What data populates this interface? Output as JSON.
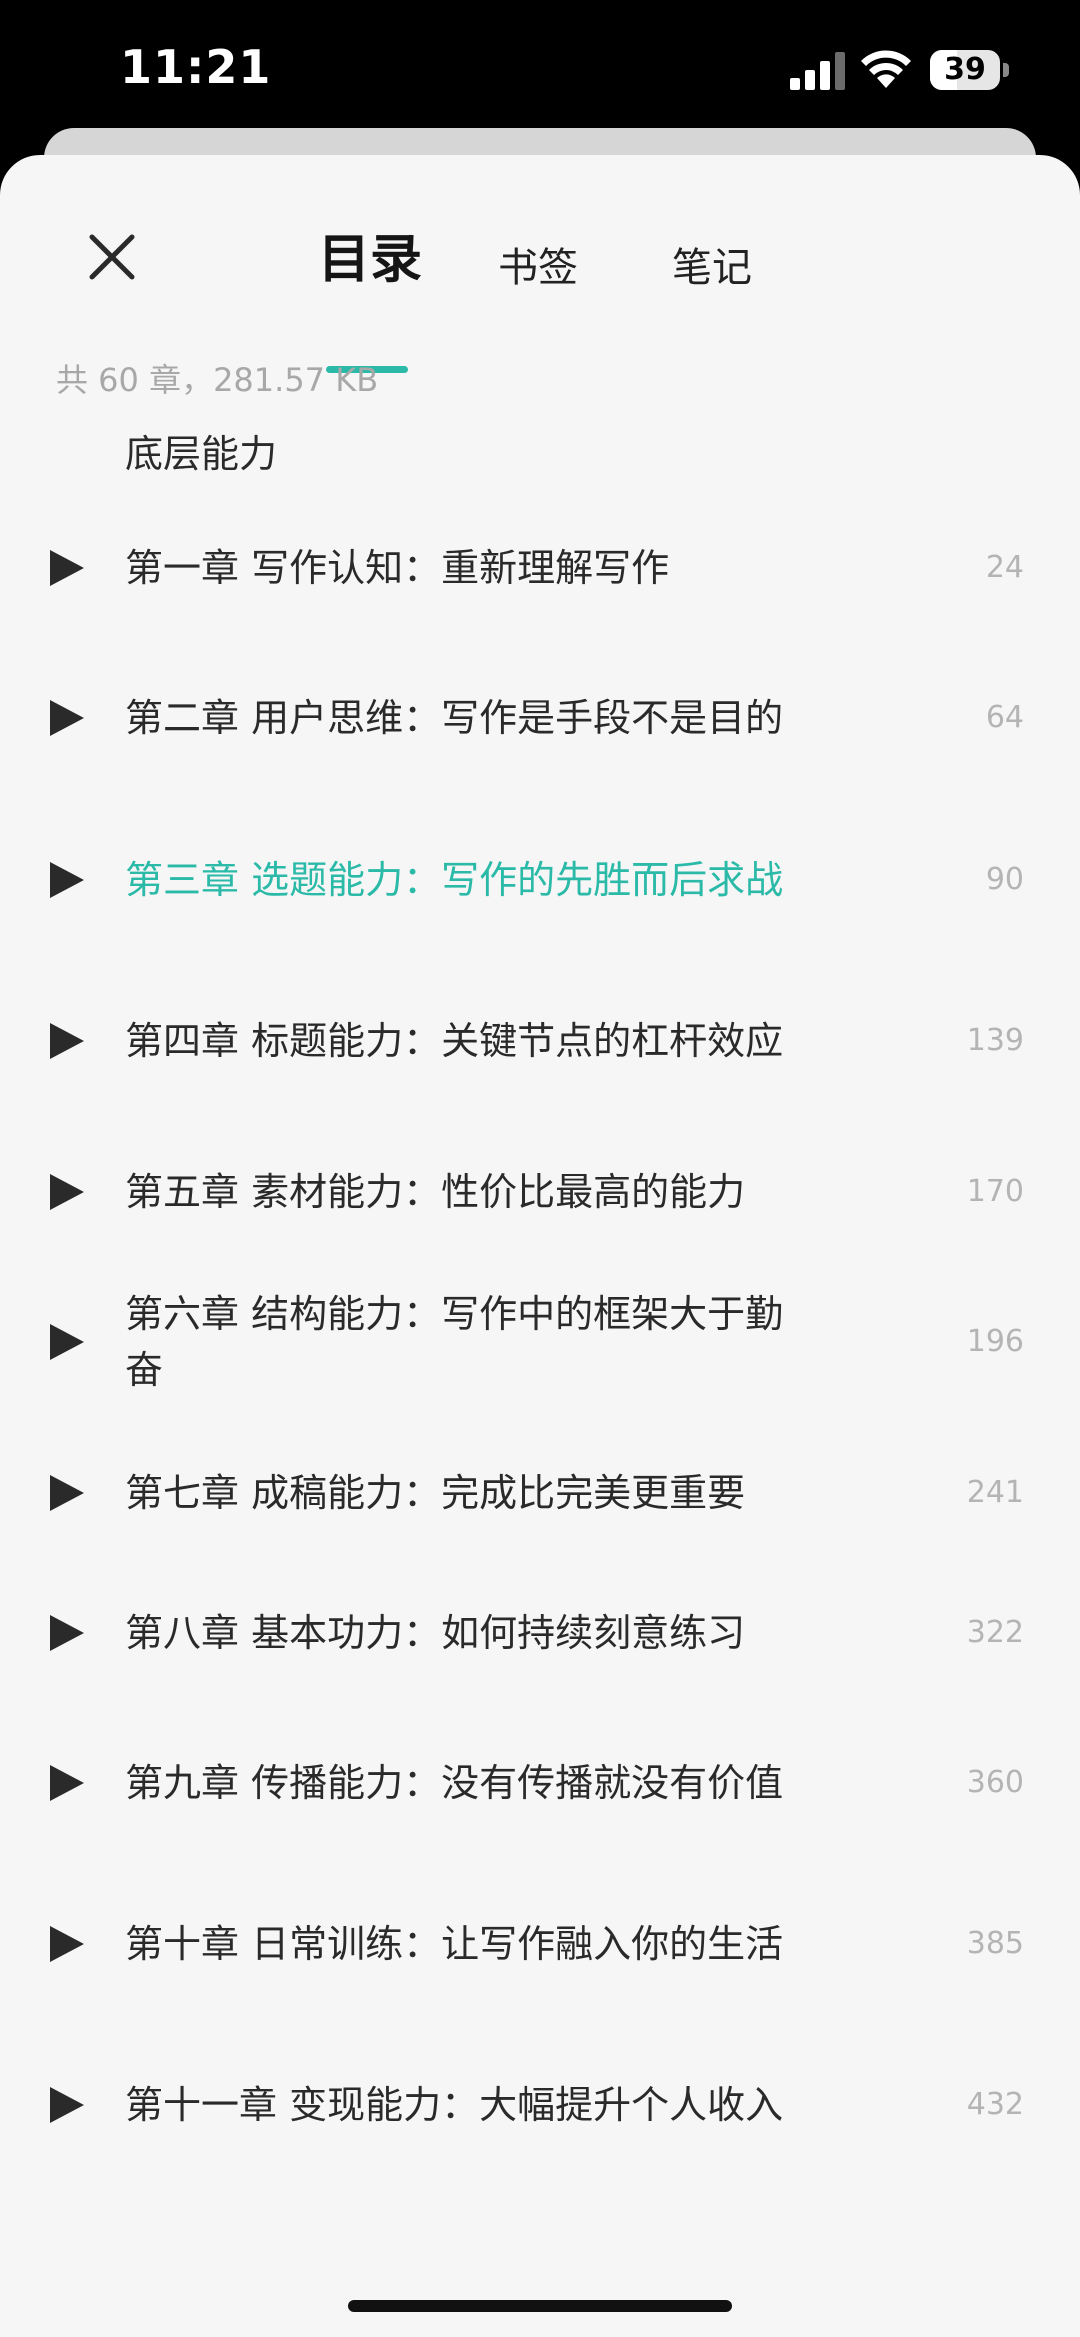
{
  "status_bar": {
    "time": "11:21",
    "battery": "39"
  },
  "tabs": [
    {
      "label": "目录",
      "active": true
    },
    {
      "label": "书签",
      "active": false
    },
    {
      "label": "笔记",
      "active": false
    }
  ],
  "book_info": "共 60 章，281.57 KB",
  "volume_title": "底层能力",
  "accent_color": "#2bbaa8",
  "chapters": [
    {
      "title": "第一章 写作认知：重新理解写作",
      "page": "24",
      "current": false
    },
    {
      "title": "第二章 用户思维：写作是手段不是目的",
      "page": "64",
      "current": false
    },
    {
      "title": "第三章 选题能力：写作的先胜而后求战",
      "page": "90",
      "current": true
    },
    {
      "title": "第四章 标题能力：关键节点的杠杆效应",
      "page": "139",
      "current": false
    },
    {
      "title": "第五章 素材能力：性价比最高的能力",
      "page": "170",
      "current": false
    },
    {
      "title": "第六章 结构能力：写作中的框架大于勤奋",
      "page": "196",
      "current": false
    },
    {
      "title": "第七章 成稿能力：完成比完美更重要",
      "page": "241",
      "current": false
    },
    {
      "title": "第八章 基本功力：如何持续刻意练习",
      "page": "322",
      "current": false
    },
    {
      "title": "第九章 传播能力：没有传播就没有价值",
      "page": "360",
      "current": false
    },
    {
      "title": "第十章 日常训练：让写作融入你的生活",
      "page": "385",
      "current": false
    },
    {
      "title": "第十一章 变现能力：大幅提升个人收入",
      "page": "432",
      "current": false
    }
  ]
}
